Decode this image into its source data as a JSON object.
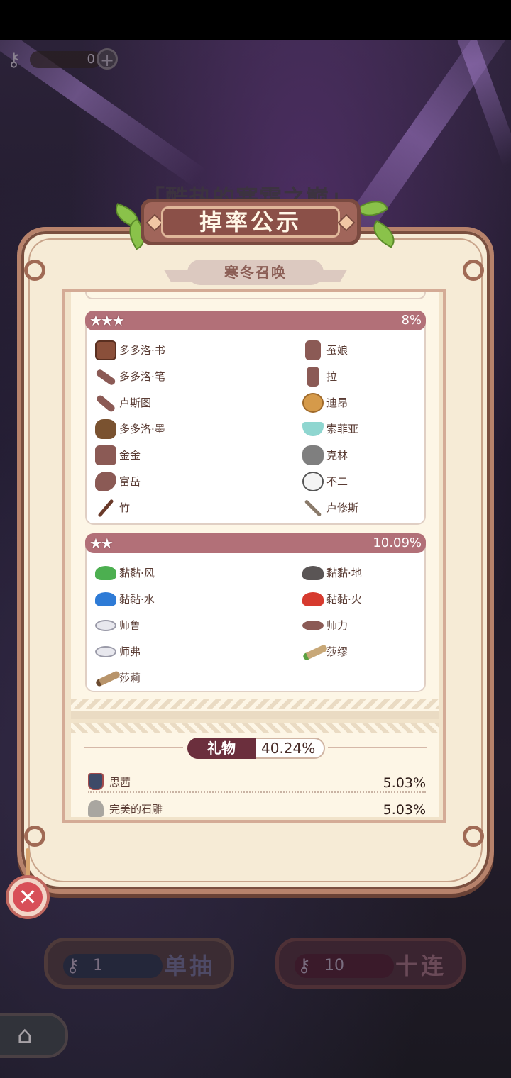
{
  "top_resource": {
    "key_icon": "key-icon",
    "count": "0",
    "plus_icon": "plus-icon"
  },
  "event_title": "「酷热的寒霜之巅」",
  "dialog": {
    "title": "掉率公示",
    "subtitle": "寒冬召唤",
    "close_icon": "close-icon"
  },
  "groups": [
    {
      "stars": "★★★",
      "rate": "8%",
      "items": [
        {
          "name": "多多洛·书",
          "icon": "book-icon",
          "color": "#8a4f3a"
        },
        {
          "name": "蚕娘",
          "icon": "silhouette-icon",
          "color": "#8b5a55"
        },
        {
          "name": "多多洛·笔",
          "icon": "quill-icon",
          "color": "#8b5a55"
        },
        {
          "name": "拉",
          "icon": "silhouette-icon",
          "color": "#8b5a55"
        },
        {
          "name": "卢斯图",
          "icon": "staff-icon",
          "color": "#8b5a55"
        },
        {
          "name": "迪昂",
          "icon": "cookie-icon",
          "color": "#d59a4a"
        },
        {
          "name": "多多洛·墨",
          "icon": "inkpot-icon",
          "color": "#7a5230"
        },
        {
          "name": "索菲亚",
          "icon": "teacup-icon",
          "color": "#8fd6d0"
        },
        {
          "name": "金金",
          "icon": "silhouette-icon",
          "color": "#8b5a55"
        },
        {
          "name": "克林",
          "icon": "watering-can-icon",
          "color": "#7f7f7f"
        },
        {
          "name": "富岳",
          "icon": "silhouette-icon",
          "color": "#8b5a55"
        },
        {
          "name": "不二",
          "icon": "snowball-icon",
          "color": "#f4f4f4"
        },
        {
          "name": "竹",
          "icon": "bamboo-stick-icon",
          "color": "#6a3a2a"
        },
        {
          "name": "卢修斯",
          "icon": "fork-icon",
          "color": "#8a7a6a"
        }
      ]
    },
    {
      "stars": "★★",
      "rate": "10.09%",
      "items": [
        {
          "name": "黏黏·风",
          "icon": "slime-green-icon",
          "color": "#4caf50"
        },
        {
          "name": "黏黏·地",
          "icon": "slime-dark-icon",
          "color": "#5a5555"
        },
        {
          "name": "黏黏·水",
          "icon": "slime-blue-icon",
          "color": "#2e7bd6"
        },
        {
          "name": "黏黏·火",
          "icon": "slime-red-icon",
          "color": "#d63a2e"
        },
        {
          "name": "师鲁",
          "icon": "white-creature-icon",
          "color": "#e8e8ee"
        },
        {
          "name": "师力",
          "icon": "silhouette-icon",
          "color": "#8b5a55"
        },
        {
          "name": "师弗",
          "icon": "white-creature-icon",
          "color": "#e8e8ee"
        },
        {
          "name": "莎缪",
          "icon": "scroll-green-icon",
          "color": "#c8a878"
        },
        {
          "name": "莎莉",
          "icon": "scroll-brown-icon",
          "color": "#b8946a"
        }
      ]
    }
  ],
  "gifts": {
    "label": "礼物",
    "rate": "40.24%",
    "items": [
      {
        "name": "思茜",
        "icon": "jar-icon",
        "rate": "5.03%"
      },
      {
        "name": "完美的石雕",
        "icon": "statue-icon",
        "rate": "5.03%"
      }
    ]
  },
  "buttons": {
    "single": {
      "count": "1",
      "label": "单抽",
      "key_icon": "key-icon"
    },
    "ten": {
      "count": "10",
      "label": "十连",
      "key_icon": "key-icon"
    },
    "home_icon": "home-icon"
  }
}
